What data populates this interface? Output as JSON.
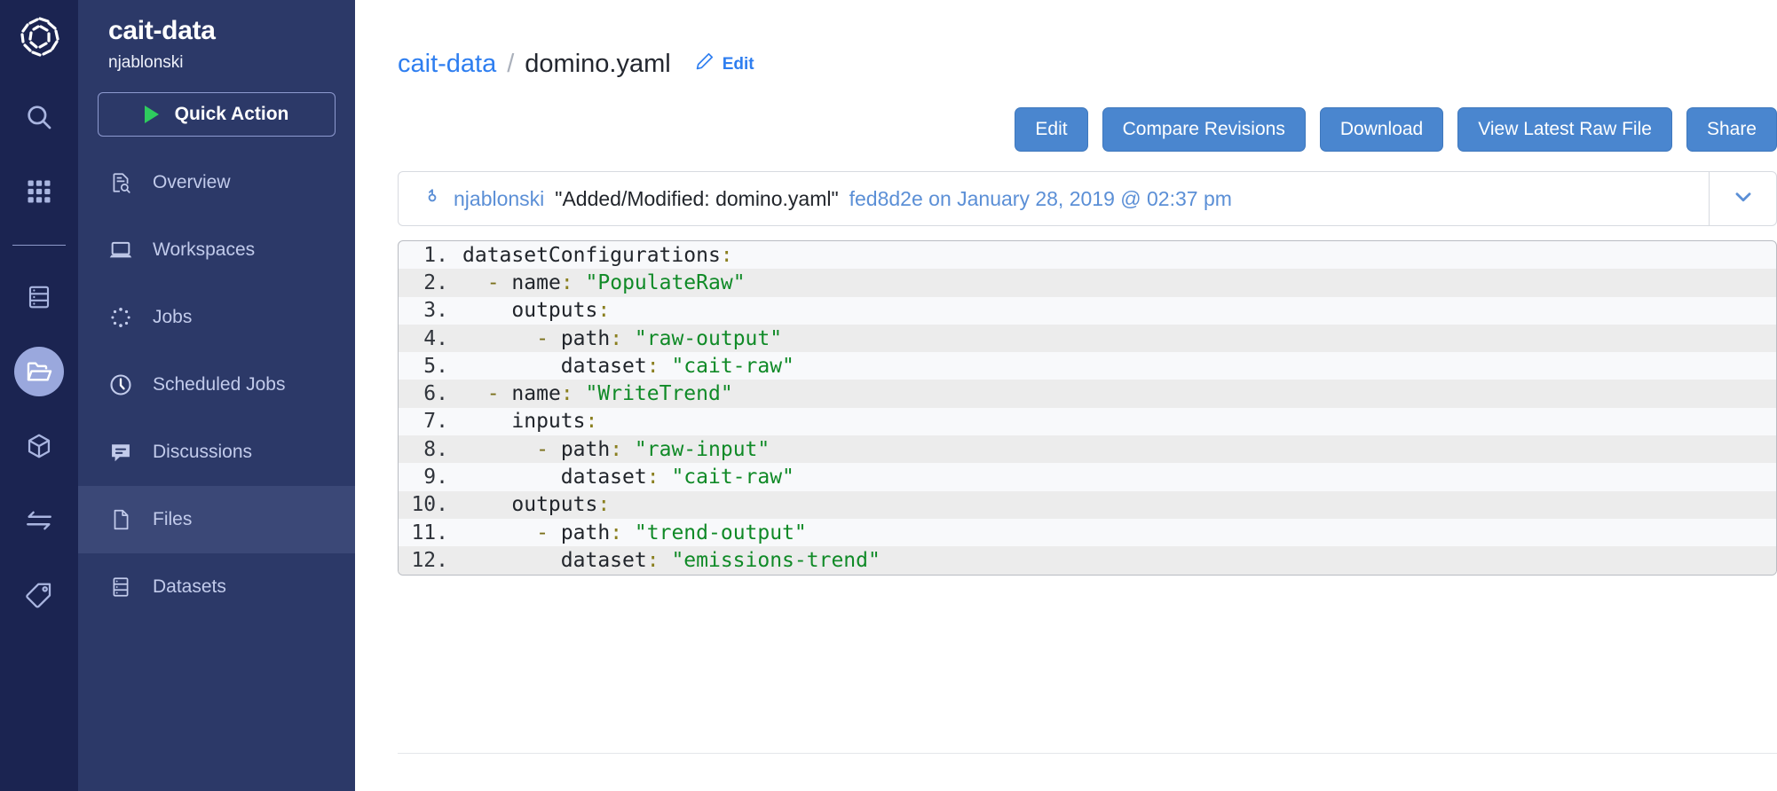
{
  "rail": {
    "logo_icon": "domino-swirl-logo",
    "items": [
      {
        "icon": "search-icon",
        "name": "search"
      },
      {
        "icon": "grid-apps-icon",
        "name": "apps"
      },
      {
        "icon": "server-stack-icon",
        "name": "environments"
      },
      {
        "icon": "folder-open-icon",
        "name": "projects",
        "active": true
      },
      {
        "icon": "cube-icon",
        "name": "models"
      },
      {
        "icon": "arrows-exchange-icon",
        "name": "transfers"
      },
      {
        "icon": "tag-icon",
        "name": "tags"
      }
    ]
  },
  "sidebar": {
    "project_title": "cait-data",
    "owner": "njablonski",
    "quick_action_label": "Quick Action",
    "items": [
      {
        "label": "Overview",
        "icon": "document-search-icon",
        "active": false
      },
      {
        "label": "Workspaces",
        "icon": "laptop-icon",
        "active": false
      },
      {
        "label": "Jobs",
        "icon": "spinner-dots-icon",
        "active": false
      },
      {
        "label": "Scheduled Jobs",
        "icon": "clock-icon",
        "active": false
      },
      {
        "label": "Discussions",
        "icon": "chat-bubble-icon",
        "active": false
      },
      {
        "label": "Files",
        "icon": "file-icon",
        "active": true
      },
      {
        "label": "Datasets",
        "icon": "database-rows-icon",
        "active": false
      }
    ]
  },
  "breadcrumb": {
    "project": "cait-data",
    "separator": "/",
    "file": "domino.yaml",
    "edit_label": "Edit",
    "edit_icon": "pencil-icon"
  },
  "toolbar": {
    "buttons": [
      "Edit",
      "Compare Revisions",
      "Download",
      "View Latest Raw File",
      "Share"
    ]
  },
  "commit": {
    "branch_icon": "commit-node-icon",
    "author": "njablonski",
    "message": "\"Added/Modified: domino.yaml\"",
    "hash_and_date": "fed8d2e on January 28, 2019 @ 02:37 pm",
    "chevron_icon": "chevron-down-icon"
  },
  "code": {
    "filename": "domino.yaml",
    "lines": [
      {
        "n": "1.",
        "indent": 0,
        "dash": false,
        "key": "datasetConfigurations",
        "value": ""
      },
      {
        "n": "2.",
        "indent": 1,
        "dash": true,
        "key": "name",
        "value": "\"PopulateRaw\""
      },
      {
        "n": "3.",
        "indent": 2,
        "dash": false,
        "key": "outputs",
        "value": ""
      },
      {
        "n": "4.",
        "indent": 3,
        "dash": true,
        "key": "path",
        "value": "\"raw-output\""
      },
      {
        "n": "5.",
        "indent": 4,
        "dash": false,
        "key": "dataset",
        "value": "\"cait-raw\""
      },
      {
        "n": "6.",
        "indent": 1,
        "dash": true,
        "key": "name",
        "value": "\"WriteTrend\""
      },
      {
        "n": "7.",
        "indent": 2,
        "dash": false,
        "key": "inputs",
        "value": ""
      },
      {
        "n": "8.",
        "indent": 3,
        "dash": true,
        "key": "path",
        "value": "\"raw-input\""
      },
      {
        "n": "9.",
        "indent": 4,
        "dash": false,
        "key": "dataset",
        "value": "\"cait-raw\""
      },
      {
        "n": "10.",
        "indent": 2,
        "dash": false,
        "key": "outputs",
        "value": ""
      },
      {
        "n": "11.",
        "indent": 3,
        "dash": true,
        "key": "path",
        "value": "\"trend-output\""
      },
      {
        "n": "12.",
        "indent": 4,
        "dash": false,
        "key": "dataset",
        "value": "\"emissions-trend\""
      }
    ]
  },
  "colors": {
    "rail_bg": "#1b2451",
    "sidebar_bg": "#2c3968",
    "sidebar_active": "#3b4877",
    "accent_link": "#2e7ef0",
    "button_blue": "#4a86cf",
    "play_green": "#2ecc5e",
    "yaml_string_green": "#108a27",
    "yaml_colon_olive": "#8a7f1f"
  }
}
